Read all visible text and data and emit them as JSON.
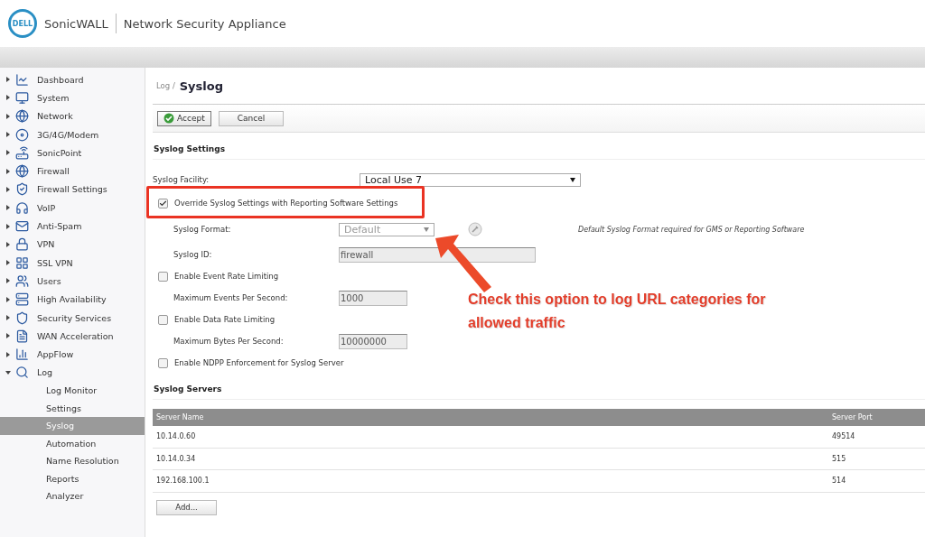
{
  "header": {
    "brand": "SonicWALL",
    "product": "Network Security Appliance",
    "logo": "DELL"
  },
  "sidebar": {
    "items": [
      {
        "label": "Dashboard",
        "expanded": false
      },
      {
        "label": "System",
        "expanded": false
      },
      {
        "label": "Network",
        "expanded": false
      },
      {
        "label": "3G/4G/Modem",
        "expanded": false
      },
      {
        "label": "SonicPoint",
        "expanded": false
      },
      {
        "label": "Firewall",
        "expanded": false
      },
      {
        "label": "Firewall Settings",
        "expanded": false
      },
      {
        "label": "VoIP",
        "expanded": false
      },
      {
        "label": "Anti-Spam",
        "expanded": false
      },
      {
        "label": "VPN",
        "expanded": false
      },
      {
        "label": "SSL VPN",
        "expanded": false
      },
      {
        "label": "Users",
        "expanded": false
      },
      {
        "label": "High Availability",
        "expanded": false
      },
      {
        "label": "Security Services",
        "expanded": false
      },
      {
        "label": "WAN Acceleration",
        "expanded": false
      },
      {
        "label": "AppFlow",
        "expanded": false
      },
      {
        "label": "Log",
        "expanded": true,
        "children": [
          {
            "label": "Log Monitor",
            "selected": false
          },
          {
            "label": "Settings",
            "selected": false
          },
          {
            "label": "Syslog",
            "selected": true
          },
          {
            "label": "Automation",
            "selected": false
          },
          {
            "label": "Name Resolution",
            "selected": false
          },
          {
            "label": "Reports",
            "selected": false
          },
          {
            "label": "Analyzer",
            "selected": false
          }
        ]
      }
    ]
  },
  "breadcrumb": {
    "parent": "Log /",
    "title": "Syslog"
  },
  "buttons": [
    {
      "label": "Accept",
      "kind": "accept"
    },
    {
      "label": "Cancel",
      "kind": "plain"
    }
  ],
  "syslog_settings": {
    "title": "Syslog Settings",
    "fields": [
      {
        "kind": "select",
        "label": "Syslog Facility:",
        "value": "Local Use 7",
        "disabled": false,
        "indented": false
      },
      {
        "kind": "checkbox",
        "label": "Override Syslog Settings with Reporting Software Settings",
        "checked": true
      },
      {
        "kind": "select",
        "label": "Syslog Format:",
        "value": "Default",
        "disabled": true,
        "indented": true,
        "note": "Default Syslog Format required for GMS or Reporting Software"
      },
      {
        "kind": "text",
        "label": "Syslog ID:",
        "value": "firewall",
        "disabled": true,
        "wide": true
      },
      {
        "kind": "checkbox",
        "label": "Enable Event Rate Limiting",
        "checked": false
      },
      {
        "kind": "text",
        "label": "Maximum Events Per Second:",
        "value": "1000",
        "disabled": true,
        "wide": false
      },
      {
        "kind": "checkbox",
        "label": "Enable Data Rate Limiting",
        "checked": false
      },
      {
        "kind": "text",
        "label": "Maximum Bytes Per Second:",
        "value": "10000000",
        "disabled": true,
        "wide": false
      },
      {
        "kind": "checkbox",
        "label": "Enable NDPP Enforcement for Syslog Server",
        "checked": false
      }
    ]
  },
  "syslog_servers": {
    "title": "Syslog Servers",
    "columns": [
      "Server Name",
      "Server Port"
    ],
    "rows": [
      [
        "10.14.0.60",
        "49514"
      ],
      [
        "10.14.0.34",
        "515"
      ],
      [
        "192.168.100.1",
        "514"
      ]
    ],
    "add_button": "Add..."
  },
  "annotation": {
    "text": "Check this option to log URL categories for allowed traffic"
  }
}
